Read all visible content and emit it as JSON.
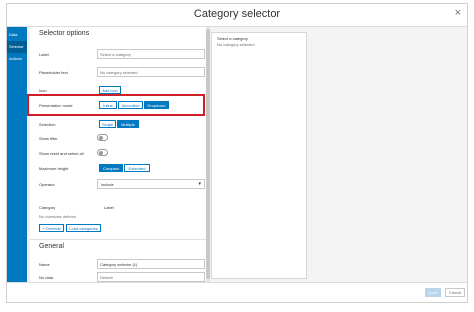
{
  "window": {
    "title": "Category selector",
    "close_glyph": "×"
  },
  "tabs": [
    {
      "label": "Data"
    },
    {
      "label": "Selector"
    },
    {
      "label": "Actions"
    }
  ],
  "selector_options": {
    "heading": "Selector options",
    "label": {
      "label": "Label",
      "placeholder": "Select a category"
    },
    "placeholder_text": {
      "label": "Placeholder text",
      "placeholder": "No category selected"
    },
    "icon": {
      "label": "Icon",
      "button": "Add icon"
    },
    "presentation_mode": {
      "label": "Presentation mode",
      "options": [
        "Inline",
        "Accordion",
        "Dropdown"
      ],
      "selected": "Dropdown"
    },
    "selection": {
      "label": "Selection",
      "options": [
        "Single",
        "Multiple"
      ],
      "selected": "Multiple"
    },
    "show_filter": {
      "label": "Show filter",
      "on": false
    },
    "show_reset": {
      "label": "Show reset and select all",
      "on": false
    },
    "max_height": {
      "label": "Maximum height",
      "options": [
        "Compact",
        "Extended"
      ],
      "selected": "Compact"
    },
    "operator": {
      "label": "Operator",
      "value": "include"
    },
    "category": {
      "label": "Category",
      "value": "Label"
    },
    "no_overrides": "No overrides defined",
    "override_button": "+ Override",
    "load_button": "Load categories"
  },
  "general": {
    "heading": "General",
    "name": {
      "label": "Name",
      "value": "Category selector (1)"
    },
    "no_data": {
      "label": "No data",
      "placeholder": "Default"
    }
  },
  "preview": {
    "title": "Select a category",
    "subtitle": "No category selected"
  },
  "footer": {
    "done": "Done",
    "cancel": "Cancel"
  },
  "colors": {
    "accent": "#0079c1",
    "highlight_border": "#d01e28"
  }
}
